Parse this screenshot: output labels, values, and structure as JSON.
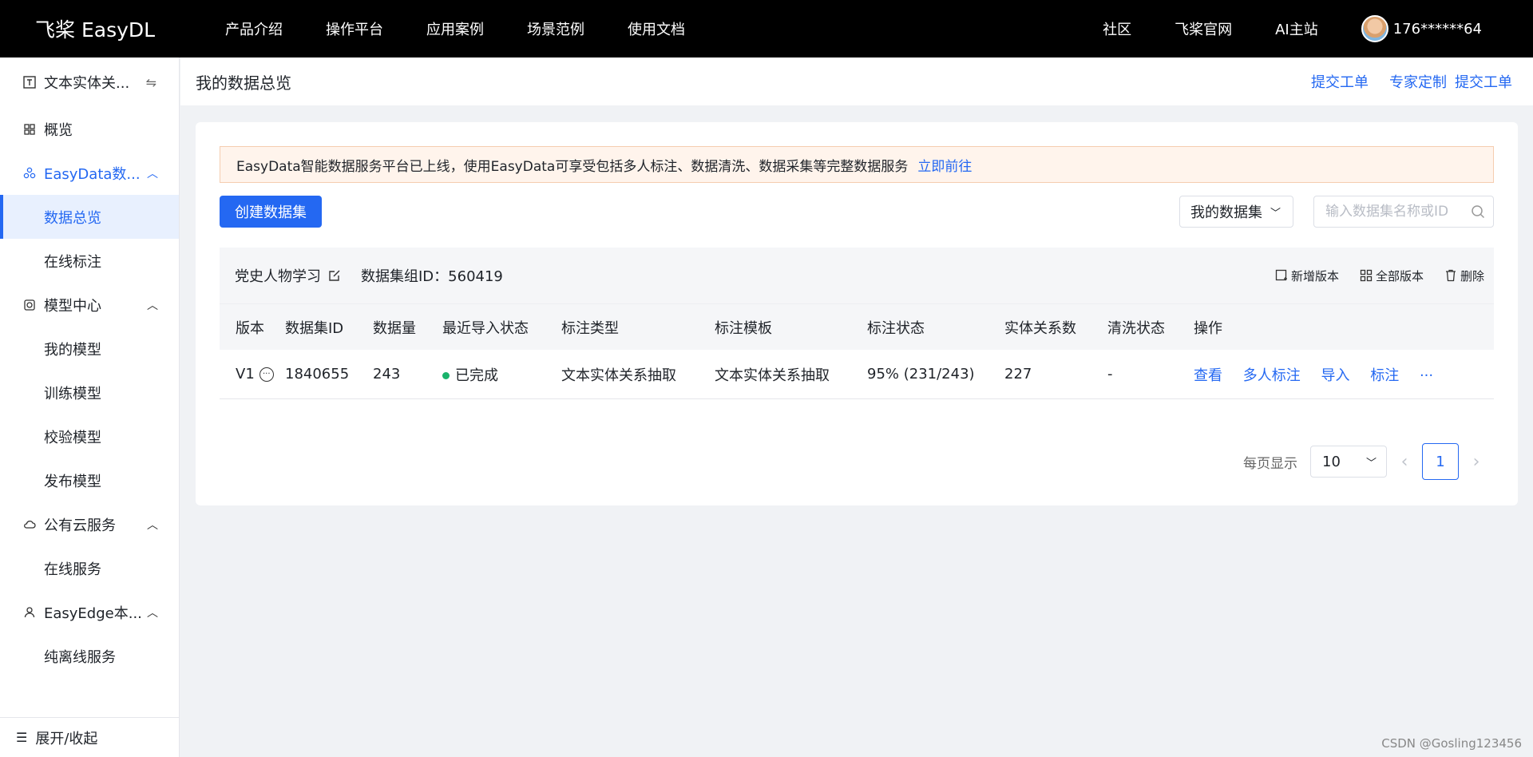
{
  "topbar": {
    "logo_mark": "㎡",
    "logo_text": "飞桨 EasyDL",
    "nav": [
      "产品介绍",
      "操作平台",
      "应用案例",
      "场景范例",
      "使用文档"
    ],
    "right_nav": [
      "社区",
      "飞桨官网",
      "AI主站"
    ],
    "user": "176******64"
  },
  "sidebar": {
    "top_label": "文本实体关...",
    "overview": "概览",
    "groups": [
      {
        "label": "EasyData数...",
        "items": [
          "数据总览",
          "在线标注"
        ]
      },
      {
        "label": "模型中心",
        "items": [
          "我的模型",
          "训练模型",
          "校验模型",
          "发布模型"
        ]
      },
      {
        "label": "公有云服务",
        "items": [
          "在线服务"
        ]
      },
      {
        "label": "EasyEdge本...",
        "items": [
          "纯离线服务"
        ]
      }
    ],
    "footer": "展开/收起"
  },
  "header": {
    "title": "我的数据总览",
    "links": [
      "提交工单",
      "专家定制",
      "提交工单"
    ]
  },
  "notice": {
    "text": "EasyData智能数据服务平台已上线，使用EasyData可享受包括多人标注、数据清洗、数据采集等完整数据服务",
    "link": "立即前往"
  },
  "toolbar": {
    "create_label": "创建数据集",
    "dataset_select": "我的数据集",
    "search_placeholder": "输入数据集名称或ID"
  },
  "group": {
    "name": "党史人物学习",
    "id_label": "数据集组ID：560419",
    "actions": [
      "新增版本",
      "全部版本",
      "删除"
    ]
  },
  "table": {
    "headers": [
      "版本",
      "数据集ID",
      "数据量",
      "最近导入状态",
      "标注类型",
      "标注模板",
      "标注状态",
      "实体关系数",
      "清洗状态",
      "操作"
    ],
    "row": {
      "version": "V1",
      "dataset_id": "1840655",
      "count": "243",
      "import_status": "已完成",
      "label_type": "文本实体关系抽取",
      "template": "文本实体关系抽取",
      "label_status": "95% (231/243)",
      "relations": "227",
      "clean_status": "-",
      "ops": [
        "查看",
        "多人标注",
        "导入",
        "标注",
        "···"
      ]
    }
  },
  "pager": {
    "label": "每页显示",
    "size": "10",
    "page": "1"
  },
  "watermark": "CSDN @Gosling123456",
  "colors": {
    "accent": "#2468f2",
    "success": "#19b36b",
    "notice_bg": "#fff4ec"
  }
}
